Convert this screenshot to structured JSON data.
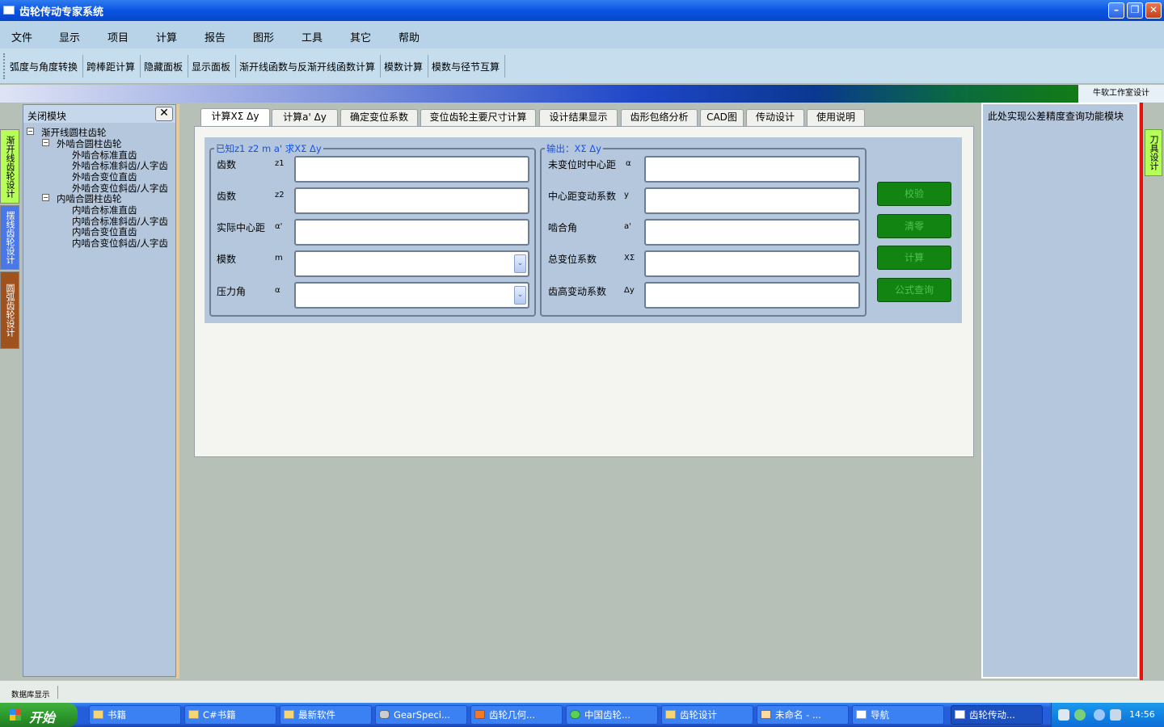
{
  "window": {
    "title": "齿轮传动专家系统",
    "buttons": {
      "minimize": "–",
      "restore": "❐",
      "close": "✕"
    }
  },
  "menu": [
    "文件",
    "显示",
    "项目",
    "计算",
    "报告",
    "图形",
    "工具",
    "其它",
    "帮助"
  ],
  "toolbar": [
    "弧度与角度转换",
    "跨棒距计算",
    "隐藏面板",
    "显示面板",
    "渐开线函数与反渐开线函数计算",
    "模数计算",
    "模数与径节互算"
  ],
  "banner": {
    "right_text": "牛软工作室设计"
  },
  "left_vtabs": [
    "渐开线齿轮设计",
    "摆线齿轮设计",
    "圆弧齿轮设计"
  ],
  "left_panel": {
    "header": "关闭模块",
    "close_glyph": "✕",
    "tree": [
      {
        "label": "渐开线圆柱齿轮",
        "level": 0,
        "toggle": "−"
      },
      {
        "label": "外啮合圆柱齿轮",
        "level": 1,
        "toggle": "−"
      },
      {
        "label": "外啮合标准直齿",
        "level": 2
      },
      {
        "label": "外啮合标准斜齿/人字齿",
        "level": 2
      },
      {
        "label": "外啮合变位直齿",
        "level": 2
      },
      {
        "label": "外啮合变位斜齿/人字齿",
        "level": 2
      },
      {
        "label": "内啮合圆柱齿轮",
        "level": 1,
        "toggle": "−"
      },
      {
        "label": "内啮合标准直齿",
        "level": 2
      },
      {
        "label": "内啮合标准斜齿/人字齿",
        "level": 2
      },
      {
        "label": "内啮合变位直齿",
        "level": 2
      },
      {
        "label": "内啮合变位斜齿/人字齿",
        "level": 2
      }
    ]
  },
  "tabs": [
    "计算XΣ Δy",
    "计算a' Δy",
    "确定变位系数",
    "变位齿轮主要尺寸计算",
    "设计结果显示",
    "齿形包络分析",
    "CAD图",
    "传动设计",
    "使用说明"
  ],
  "input_group": {
    "legend": "已知z1 z2 m a' 求XΣ Δy",
    "fields": [
      {
        "label": "齿数",
        "symbol": "z1",
        "value": ""
      },
      {
        "label": "齿数",
        "symbol": "z2",
        "value": ""
      },
      {
        "label": "实际中心距",
        "symbol": "α'",
        "value": ""
      },
      {
        "label": "模数",
        "symbol": "m",
        "value": ""
      },
      {
        "label": "压力角",
        "symbol": "α",
        "value": ""
      }
    ],
    "dropdown_glyph": "⌄"
  },
  "output_group": {
    "legend": "输出：XΣ Δy",
    "fields": [
      {
        "label": "未变位时中心距",
        "symbol": "α",
        "value": ""
      },
      {
        "label": "中心距变动系数",
        "symbol": "y",
        "value": ""
      },
      {
        "label": "啮合角",
        "symbol": "a'",
        "value": ""
      },
      {
        "label": "总变位系数",
        "symbol": "XΣ",
        "value": ""
      },
      {
        "label": "齿高变动系数",
        "symbol": "Δy",
        "value": ""
      }
    ]
  },
  "action_buttons": [
    "校验",
    "清零",
    "计算",
    "公式查询"
  ],
  "right_panel": {
    "text": "此处实现公差精度查询功能模块",
    "vtab": "刀具设计"
  },
  "statusbar": {
    "text": "数据库显示"
  },
  "taskbar": {
    "start": "开始",
    "items": [
      "书籍",
      "C#书籍",
      "最新软件",
      "GearSpeci...",
      "齿轮几何...",
      "中国齿轮...",
      "齿轮设计",
      "未命名 - ...",
      "导航",
      "齿轮传动..."
    ],
    "clock": "14:56"
  },
  "colors": {
    "title_bar": "#0a54e2",
    "menu_bg": "#b8d3e7",
    "panel_bg": "#b5c7dc",
    "button_green": "#118411",
    "red_bar": "#e81010"
  }
}
